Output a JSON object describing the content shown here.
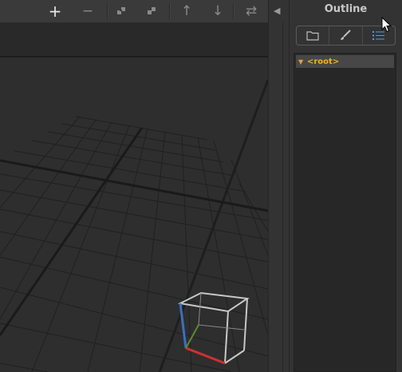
{
  "toolbar": {
    "buttons": [
      {
        "name": "add-button",
        "icon": "plus-icon",
        "glyph": "+"
      },
      {
        "name": "remove-button",
        "icon": "minus-icon",
        "glyph": "−"
      },
      {
        "name": "reparent-button",
        "icon": "node-reparent-icon"
      },
      {
        "name": "instance-button",
        "icon": "node-instance-icon"
      },
      {
        "name": "move-up-button",
        "icon": "arrow-up-icon",
        "glyph": "↑"
      },
      {
        "name": "move-down-button",
        "icon": "arrow-down-icon",
        "glyph": "↓"
      },
      {
        "name": "swap-button",
        "icon": "swap-icon",
        "glyph": "⇄"
      }
    ]
  },
  "splitter": {
    "collapse_glyph": "◀"
  },
  "outline": {
    "title": "Outline",
    "tabs": [
      {
        "name": "tab-files",
        "icon": "folder-icon"
      },
      {
        "name": "tab-materials",
        "icon": "brush-icon"
      },
      {
        "name": "tab-outline",
        "icon": "list-icon",
        "selected": true
      }
    ],
    "tree": {
      "expand_glyph": "▼",
      "root_label": "<root>"
    }
  },
  "colors": {
    "accent_label": "#f0b020",
    "axis_x": "#d03030",
    "axis_y": "#5a8a30",
    "axis_z": "#3a70c0",
    "tab_selected": "#5a9ad6"
  }
}
